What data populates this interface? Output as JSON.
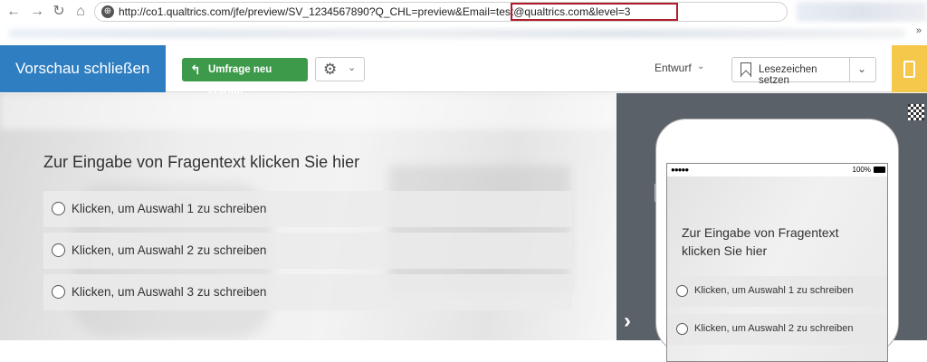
{
  "browser": {
    "back_icon": "←",
    "forward_icon": "→",
    "reload_icon": "↻",
    "home_icon": "⌂",
    "url": "http://co1.qualtrics.com/jfe/preview/SV_1234567890?Q_CHL=preview&Email=test@qualtrics.com&level=3",
    "bookmarks_more": "»"
  },
  "toolbar": {
    "close_preview_label": "Vorschau schließen",
    "restart_label": "Umfrage neu starten",
    "draft_label": "Entwurf",
    "bookmark_label": "Lesezeichen setzen"
  },
  "survey": {
    "question": "Zur Eingabe von Fragentext klicken Sie hier",
    "choices": [
      "Klicken, um Auswahl 1 zu schreiben",
      "Klicken, um Auswahl 2 zu schreiben",
      "Klicken, um Auswahl 3 zu schreiben"
    ]
  },
  "mobile": {
    "signal": "●●●●●",
    "battery": "100%",
    "question": "Zur Eingabe von Fragentext klicken Sie hier",
    "choices": [
      "Klicken, um Auswahl 1 zu schreiben",
      "Klicken, um Auswahl 2 zu schreiben"
    ],
    "next_icon": "›"
  },
  "colors": {
    "close_preview_bg": "#2f7ec1",
    "restart_bg": "#3d9a4a",
    "device_toggle_bg": "#f5c84c",
    "mobile_panel_bg": "#5b6168",
    "url_highlight": "#b01c2b"
  }
}
